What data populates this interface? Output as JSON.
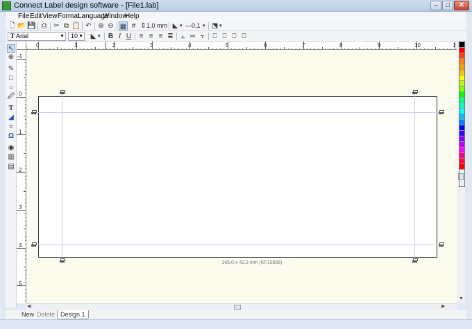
{
  "window": {
    "title": "Connect Label design software - [File1.lab]",
    "min_glyph": "–",
    "max_glyph": "□",
    "close_glyph": "✕"
  },
  "menu": [
    "File",
    "Edit",
    "View",
    "Format",
    "Language",
    "Window",
    "Help"
  ],
  "toolbar1": {
    "grid_size": "1,0 mm",
    "line_width": "0,1"
  },
  "toolbar2": {
    "font_name": "Arial",
    "font_size": "10",
    "bold": "B",
    "italic": "I",
    "underline": "U"
  },
  "ruler_h": [
    "0",
    "1",
    "2",
    "3",
    "4",
    "5",
    "6",
    "7",
    "8",
    "9",
    "10",
    "1"
  ],
  "ruler_h_neg": "1",
  "ruler_v": [
    "-1",
    "0",
    "1",
    "2",
    "3",
    "4",
    "5"
  ],
  "label": {
    "size_caption": "105,0 x 42,3 mm (KF10656)"
  },
  "colors": [
    "#000000",
    "#ff0000",
    "#ff4000",
    "#ff8000",
    "#ffa000",
    "#ffc000",
    "#ffff00",
    "#c0ff00",
    "#80ff00",
    "#00ff00",
    "#00ff80",
    "#00ffc0",
    "#00ffff",
    "#00c0ff",
    "#0080ff",
    "#0000ff",
    "#4000ff",
    "#8000ff",
    "#c000ff",
    "#ff00ff",
    "#ff0080",
    "#ff0040",
    "#ff0000"
  ],
  "tabs": {
    "new": "New",
    "delete": "Delete",
    "design": "Design 1"
  }
}
